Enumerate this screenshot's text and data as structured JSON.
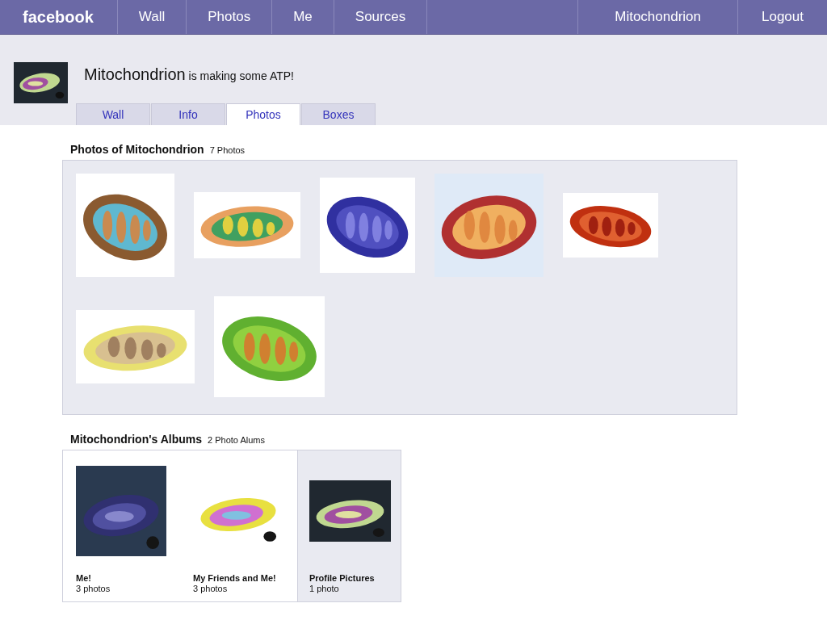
{
  "top_bar": {
    "logo": "facebook",
    "nav": [
      "Wall",
      "Photos",
      "Me",
      "Sources"
    ],
    "user": "Mitochondrion",
    "logout": "Logout"
  },
  "profile": {
    "name": "Mitochondrion",
    "status": "is making some ATP!"
  },
  "tabs": [
    {
      "label": "Wall",
      "selected": false
    },
    {
      "label": "Info",
      "selected": false
    },
    {
      "label": "Photos",
      "selected": true
    },
    {
      "label": "Boxes",
      "selected": false
    }
  ],
  "photos_section": {
    "title": "Photos of Mitochondrion",
    "count": "7 Photos"
  },
  "albums_section": {
    "title": "Mitochondrion's Albums",
    "count": "2 Photo Alums",
    "albums": [
      {
        "title": "Me!",
        "count": "3 photos",
        "selected": false
      },
      {
        "title": "My Friends and Me!",
        "count": "3 photos",
        "selected": false
      },
      {
        "title": "Profile Pictures",
        "count": "1 photo",
        "selected": true
      }
    ]
  }
}
